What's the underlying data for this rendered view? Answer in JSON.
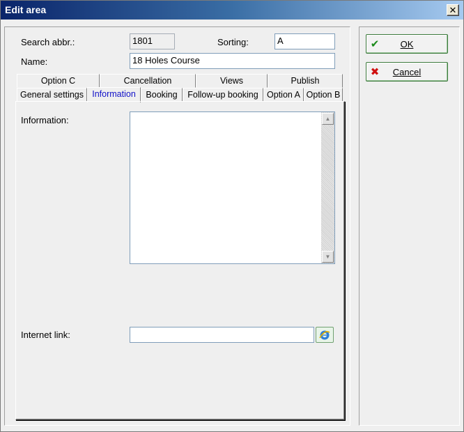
{
  "window": {
    "title": "Edit area"
  },
  "form": {
    "search_abbr_label": "Search abbr.:",
    "search_abbr_value": "1801",
    "sorting_label": "Sorting:",
    "sorting_value": "A",
    "name_label": "Name:",
    "name_value": "18 Holes Course"
  },
  "tabs": {
    "row_back": [
      "Option C",
      "Cancellation",
      "Views",
      "Publish"
    ],
    "row_front": [
      "General settings",
      "Information",
      "Booking",
      "Follow-up booking",
      "Option A",
      "Option B"
    ],
    "active": "Information"
  },
  "information": {
    "info_label": "Information:",
    "info_value": "",
    "internet_link_label": "Internet link:",
    "internet_link_value": ""
  },
  "buttons": {
    "ok": "OK",
    "cancel": "Cancel"
  },
  "icons": {
    "close": "close-icon",
    "ok": "checkmark-icon",
    "cancel": "cross-icon",
    "link": "internet-explorer-icon"
  },
  "colors": {
    "ok_icon": "#1a8a1a",
    "cancel_icon": "#d01010",
    "active_tab": "#1010c8"
  }
}
